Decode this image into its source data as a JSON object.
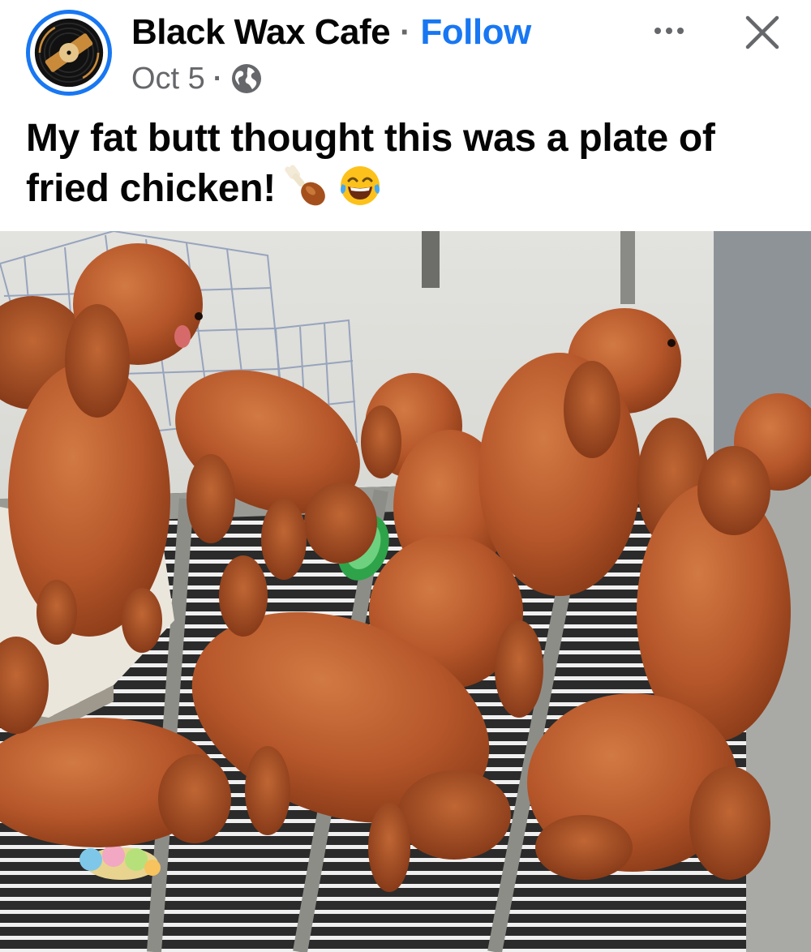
{
  "post": {
    "page_name": "Black Wax Cafe",
    "separator": "·",
    "follow_label": "Follow",
    "date": "Oct 5",
    "audience_icon": "globe-icon",
    "more_icon": "more-options-icon",
    "close_icon": "close-icon",
    "caption": "My fat butt thought this was a plate of fried chicken!",
    "caption_emojis": [
      "poultry-leg-emoji",
      "tears-of-joy-emoji"
    ],
    "photo_subject": "red poodle puppies on a wire grate"
  },
  "colors": {
    "link": "#1877f2",
    "secondary_text": "#65676b",
    "primary_text": "#050505",
    "avatar_ring": "#1877f2",
    "puppy_fur": "#b5562a"
  }
}
